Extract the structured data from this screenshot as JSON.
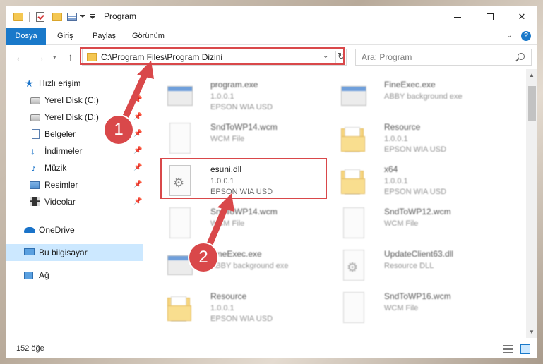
{
  "window": {
    "title": "Program",
    "controls": {
      "minimize": "—",
      "maximize": "☐",
      "close": "✕"
    }
  },
  "ribbon": {
    "tabs": [
      "Dosya",
      "Giriş",
      "Paylaş",
      "Görünüm"
    ],
    "help": "?"
  },
  "nav": {
    "address": "C:\\Program Files\\Program Dizini",
    "search_placeholder": "Ara: Program"
  },
  "sidebar": {
    "items": [
      {
        "label": "Hızlı erişim",
        "icon": "star-icon"
      },
      {
        "label": "Yerel Disk (C:)",
        "icon": "disk-icon",
        "pinned": true
      },
      {
        "label": "Yerel Disk (D:)",
        "icon": "disk-icon",
        "pinned": true
      },
      {
        "label": "Belgeler",
        "icon": "documents-icon",
        "pinned": true
      },
      {
        "label": "İndirmeler",
        "icon": "download-icon",
        "pinned": true
      },
      {
        "label": "Müzik",
        "icon": "music-icon",
        "pinned": true
      },
      {
        "label": "Resimler",
        "icon": "pictures-icon",
        "pinned": true
      },
      {
        "label": "Videolar",
        "icon": "videos-icon",
        "pinned": true
      },
      {
        "label": "OneDrive",
        "icon": "cloud-icon"
      },
      {
        "label": "Bu bilgisayar",
        "icon": "computer-icon",
        "selected": true
      },
      {
        "label": "Ağ",
        "icon": "network-icon"
      }
    ]
  },
  "files": [
    {
      "name": "program.exe",
      "line2": "1.0.0.1",
      "line3": "EPSON WIA USD",
      "type": "exe"
    },
    {
      "name": "FineExec.exe",
      "line2": "ABBY background exe",
      "line3": "",
      "type": "exe"
    },
    {
      "name": "SndToWP14.wcm",
      "line2": "WCM File",
      "line3": "",
      "type": "page"
    },
    {
      "name": "Resource",
      "line2": "1.0.0.1",
      "line3": "EPSON WIA USD",
      "type": "folder"
    },
    {
      "name": "esuni.dll",
      "line2": "1.0.0.1",
      "line3": "EPSON WIA USD",
      "type": "dll"
    },
    {
      "name": "x64",
      "line2": "1.0.0.1",
      "line3": "EPSON WIA USD",
      "type": "folder"
    },
    {
      "name": "SndToWP14.wcm",
      "line2": "WCM File",
      "line3": "",
      "type": "page"
    },
    {
      "name": "SndToWP12.wcm",
      "line2": "WCM File",
      "line3": "",
      "type": "page"
    },
    {
      "name": "FineExec.exe",
      "line2": "ABBY background exe",
      "line3": "",
      "type": "exe"
    },
    {
      "name": "UpdateClient63.dll",
      "line2": "Resource DLL",
      "line3": "",
      "type": "dll"
    },
    {
      "name": "Resource",
      "line2": "1.0.0.1",
      "line3": "EPSON WIA USD",
      "type": "folder"
    },
    {
      "name": "SndToWP16.wcm",
      "line2": "WCM File",
      "line3": "",
      "type": "page"
    }
  ],
  "status": {
    "count": "152 öğe"
  },
  "callouts": {
    "one": "1",
    "two": "2"
  },
  "colors": {
    "accent": "#1979ca",
    "highlight": "#d9484a",
    "selected_nav": "#cce8ff"
  }
}
